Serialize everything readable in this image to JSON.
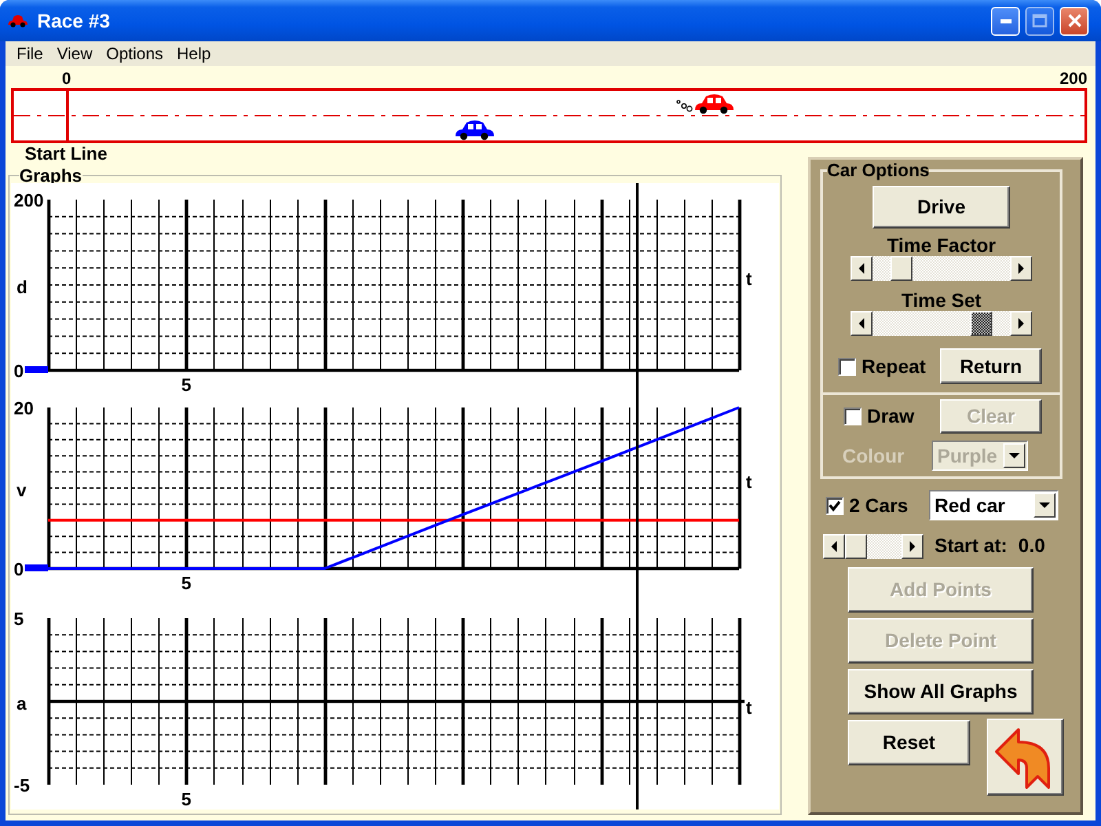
{
  "window": {
    "title": "Race #3"
  },
  "menu": [
    {
      "label": "File"
    },
    {
      "label": "View"
    },
    {
      "label": "Options"
    },
    {
      "label": "Help"
    }
  ],
  "track": {
    "start_label": "0",
    "end_label": "200",
    "caption": "Start Line",
    "cars": [
      {
        "color": "#0000ff",
        "level": 0.4,
        "moving": false
      },
      {
        "color": "#ff0000",
        "level": 0.617,
        "moving": true
      }
    ]
  },
  "graphs": {
    "title": "Graphs",
    "time_cursor": {
      "level": 0.852
    },
    "panels": [
      {
        "marker": {
          "color": "#0000ff"
        },
        "centered_axis": false,
        "y_label": "d",
        "x_label": "t",
        "top_tick": "200",
        "bottom_tick": "0",
        "time_tick": "5"
      },
      {
        "marker": {
          "color": "#0000ff"
        },
        "chart_data": {
          "type": "line",
          "xlabel": "t",
          "ylabel": "v",
          "ylim": [
            0,
            20
          ],
          "yticks": [
            0,
            20
          ],
          "grid": true,
          "categories": [
            null,
            "5",
            null,
            null,
            null,
            null
          ],
          "series": [
            {
              "color": "#ff0000",
              "values": [
                6,
                6,
                6,
                6,
                6,
                6
              ]
            },
            {
              "color": "#0000ff",
              "values": [
                0,
                0,
                0,
                6.7,
                13.3,
                20
              ]
            }
          ]
        }
      },
      {
        "centered_axis": true,
        "y_label": "a",
        "x_label": "t",
        "top_tick": "5",
        "bottom_tick": "-5",
        "time_tick": "5"
      }
    ]
  },
  "car_options": {
    "title": "Car Options",
    "drive_button": "Drive",
    "time_factor": {
      "label": "Time Factor",
      "level": 0.15,
      "focused": false
    },
    "time_set": {
      "label": "Time Set",
      "level": 0.84,
      "focused": true
    },
    "repeat": {
      "label": "Repeat",
      "checked": false
    },
    "return_button": {
      "label": "Return",
      "disabled": false
    },
    "draw": {
      "label": "Draw",
      "checked": false
    },
    "clear_button": {
      "label": "Clear",
      "disabled": true
    },
    "colour": {
      "label": "Colour",
      "value": "Purple",
      "disabled": true
    }
  },
  "two_cars": {
    "label": "2 Cars",
    "checked": true
  },
  "car_select": {
    "value": "Red car",
    "disabled": false
  },
  "start": {
    "level": 0,
    "focused": false,
    "label": "Start at:",
    "value": "0.0"
  },
  "buttons": [
    {
      "label": "Add Points",
      "disabled": true
    },
    {
      "label": "Delete Point",
      "disabled": true
    },
    {
      "label": "Show All Graphs",
      "disabled": false
    },
    {
      "label": "Reset",
      "disabled": false
    }
  ]
}
